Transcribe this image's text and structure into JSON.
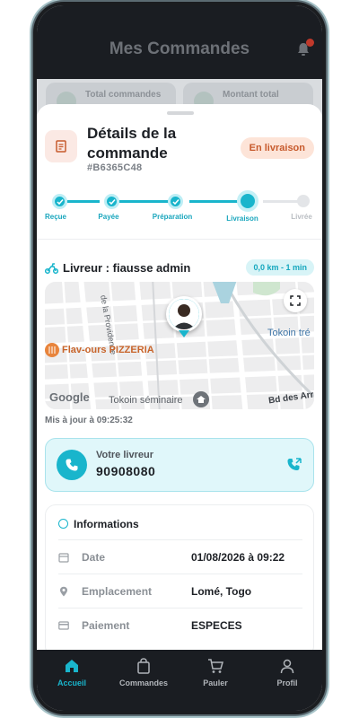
{
  "topbar": {
    "title": "Mes Commandes"
  },
  "stats": {
    "total_orders_label": "Total commandes",
    "total_amount_label": "Montant total"
  },
  "order": {
    "title": "Détails de la commande",
    "id": "#B6365C48",
    "status": "En livraison",
    "status_colors": {
      "bg": "#fde4d8",
      "text": "#c75a2c"
    }
  },
  "steps": [
    {
      "label": "Reçue",
      "state": "done"
    },
    {
      "label": "Payée",
      "state": "done"
    },
    {
      "label": "Préparation",
      "state": "done"
    },
    {
      "label": "Livraison",
      "state": "active"
    },
    {
      "label": "Livrée",
      "state": "pending"
    }
  ],
  "courier": {
    "title": "Livreur : fiausse admin",
    "distance_eta": "0,0 km - 1 min",
    "updated": "Mis à jour à 09:25:32"
  },
  "map": {
    "poi_restaurant": "Flav-ours PIZZERIA",
    "poi_school": "Tokoin séminaire",
    "area_right": "Tokoin tré",
    "street_vertical": "de la Providence",
    "street_corner": "Bd des Arr",
    "attribution": "Google"
  },
  "call": {
    "label": "Votre livreur",
    "number": "90908080"
  },
  "info": {
    "title": "Informations",
    "rows": [
      {
        "label": "Date",
        "value": "01/08/2026 à 09:22",
        "icon": "calendar-icon"
      },
      {
        "label": "Emplacement",
        "value": "Lomé, Togo",
        "icon": "location-pin-icon"
      },
      {
        "label": "Paiement",
        "value": "ESPECES",
        "icon": "credit-card-icon"
      }
    ]
  },
  "nav": [
    {
      "label": "Accueil",
      "icon": "home-icon",
      "active": true
    },
    {
      "label": "Commandes",
      "icon": "shopping-bag-icon",
      "active": false
    },
    {
      "label": "Pauler",
      "icon": "cart-icon",
      "active": false
    },
    {
      "label": "Profil",
      "icon": "user-icon",
      "active": false
    }
  ],
  "colors": {
    "accent": "#19b5cc",
    "dark": "#1a1d22"
  }
}
